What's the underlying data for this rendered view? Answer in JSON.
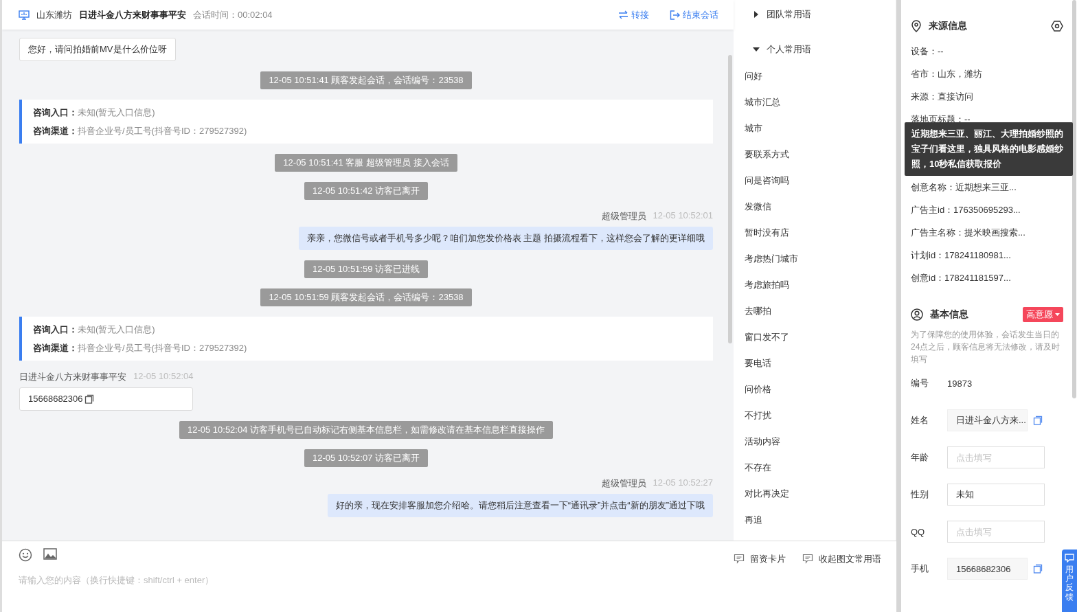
{
  "header": {
    "location": "山东潍坊",
    "visitor": "日进斗金八方来财事事平安",
    "duration": "会话时间：00:02:04",
    "actions": [
      {
        "kind": "transfer",
        "label": "转接"
      },
      {
        "kind": "end",
        "label": "结束会话"
      }
    ]
  },
  "messages": [
    {
      "kind": "customer",
      "text": "您好，请问拍婚前MV是什么价位呀",
      "copy": false
    },
    {
      "kind": "system",
      "text": "12-05 10:51:41 顾客发起会话，会话编号：23538"
    },
    {
      "kind": "info",
      "rows": [
        {
          "label": "咨询入口：",
          "value": "未知(暂无入口信息)"
        },
        {
          "label": "咨询渠道：",
          "value": "抖音企业号/员工号(抖音号ID：279527392)"
        }
      ]
    },
    {
      "kind": "system",
      "text": "12-05 10:51:41 客服 超级管理员 接入会话"
    },
    {
      "kind": "system",
      "text": "12-05 10:51:42 访客已离开"
    },
    {
      "kind": "agent",
      "sender": "超级管理员",
      "time": "12-05 10:52:01",
      "text": "亲亲，您微信号或者手机号多少呢？咱们加您发价格表 主题 拍摄流程看下，这样您会了解的更详细哦"
    },
    {
      "kind": "system",
      "text": "12-05 10:51:59 访客已进线"
    },
    {
      "kind": "system",
      "text": "12-05 10:51:59 顾客发起会话，会话编号：23538"
    },
    {
      "kind": "info",
      "rows": [
        {
          "label": "咨询入口：",
          "value": "未知(暂无入口信息)"
        },
        {
          "label": "咨询渠道：",
          "value": "抖音企业号/员工号(抖音号ID：279527392)"
        }
      ]
    },
    {
      "kind": "customer",
      "sender": "日进斗金八方来财事事平安",
      "time": "12-05 10:52:04",
      "text": "15668682306",
      "copy": true
    },
    {
      "kind": "system",
      "text": "12-05 10:52:04 访客手机号已自动标记右侧基本信息栏，如需修改请在基本信息栏直接操作"
    },
    {
      "kind": "system",
      "text": "12-05 10:52:07 访客已离开"
    },
    {
      "kind": "agent",
      "sender": "超级管理员",
      "time": "12-05 10:52:27",
      "text": "好的亲，现在安排客服加您介绍哈。请您稍后注意查看一下“通讯录”并点击“新的朋友”通过下哦"
    }
  ],
  "composer": {
    "placeholder": "请输入您的内容（换行快捷键：shift/ctrl + enter）",
    "actions": [
      {
        "label": "留资卡片"
      },
      {
        "label": "收起图文常用语"
      }
    ]
  },
  "phrase_groups": [
    {
      "label": "团队常用语",
      "expanded": false
    },
    {
      "label": "个人常用语",
      "expanded": true,
      "items": [
        "问好",
        "城市汇总",
        "城市",
        "要联系方式",
        "问是咨询吗",
        "发微信",
        "暂时没有店",
        "考虑热门城市",
        "考虑旅拍吗",
        "去哪拍",
        "窗口发不了",
        "要电话",
        "问价格",
        "不打扰",
        "活动内容",
        "不存在",
        "对比再决定",
        "再追"
      ]
    }
  ],
  "source_info": {
    "title": "来源信息",
    "rows_before": [
      "设备：--",
      "省市：山东，潍坊",
      "来源：直接访问",
      "落地页标题：--"
    ],
    "tooltip": "近期想来三亚、丽江、大理拍婚纱照的宝子们看这里，独具风格的电影感婚纱照，10秒私信获取报价",
    "rows_after": [
      "创意名称：近期想来三亚...",
      "广告主id：176350695293...",
      "广告主名称：提米映画搜索...",
      "计划id：178241180981...",
      "创意id：178241181597..."
    ]
  },
  "basic_info": {
    "title": "基本信息",
    "tag": "高意愿",
    "note": "为了保障您的使用体验，会话发生当日的24点之后，顾客信息将无法修改，请及时填写",
    "fields": [
      {
        "kind": "plain",
        "label": "编号",
        "value": "19873"
      },
      {
        "kind": "readonly",
        "label": "姓名",
        "value": "日进斗金八方来..."
      },
      {
        "kind": "input",
        "label": "年龄",
        "placeholder": "点击填写"
      },
      {
        "kind": "input",
        "label": "性别",
        "value": "未知"
      },
      {
        "kind": "input",
        "label": "QQ",
        "placeholder": "点击填写"
      },
      {
        "kind": "readonly",
        "label": "手机",
        "value": "15668682306"
      }
    ]
  },
  "feedback": {
    "label": "用户反馈"
  }
}
